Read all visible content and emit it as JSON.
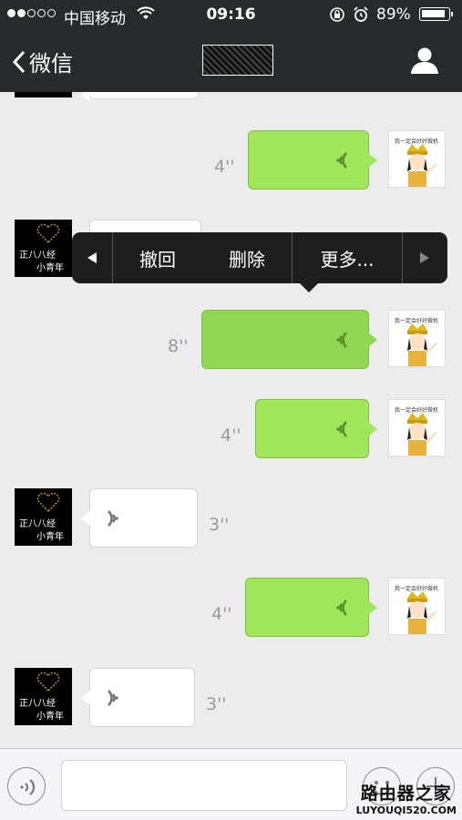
{
  "status": {
    "carrier": "中国移动",
    "time": "09:16",
    "battery": "89%",
    "battery_level": 0.89
  },
  "nav": {
    "back_label": "微信"
  },
  "popup": {
    "recall": "撤回",
    "delete": "删除",
    "more": "更多..."
  },
  "messages": [
    {
      "side": "out",
      "duration": "4''"
    },
    {
      "side": "in",
      "duration": ""
    },
    {
      "side": "out",
      "duration": "8''",
      "selected": true
    },
    {
      "side": "out",
      "duration": "4''"
    },
    {
      "side": "in",
      "duration": "3''"
    },
    {
      "side": "out",
      "duration": "4''"
    },
    {
      "side": "in",
      "duration": "3''"
    }
  ],
  "avatar_in": {
    "line1": "正八八经",
    "line2": "小青年"
  },
  "avatar_out": {
    "caption": "我一定会好好做机"
  },
  "watermark": {
    "line1": "路由器之家",
    "line2": "LUYOUQI520.COM"
  },
  "colors": {
    "bubble_out": "#a0e65a",
    "navbar": "#282a2c",
    "popup": "#1e1e1e"
  }
}
